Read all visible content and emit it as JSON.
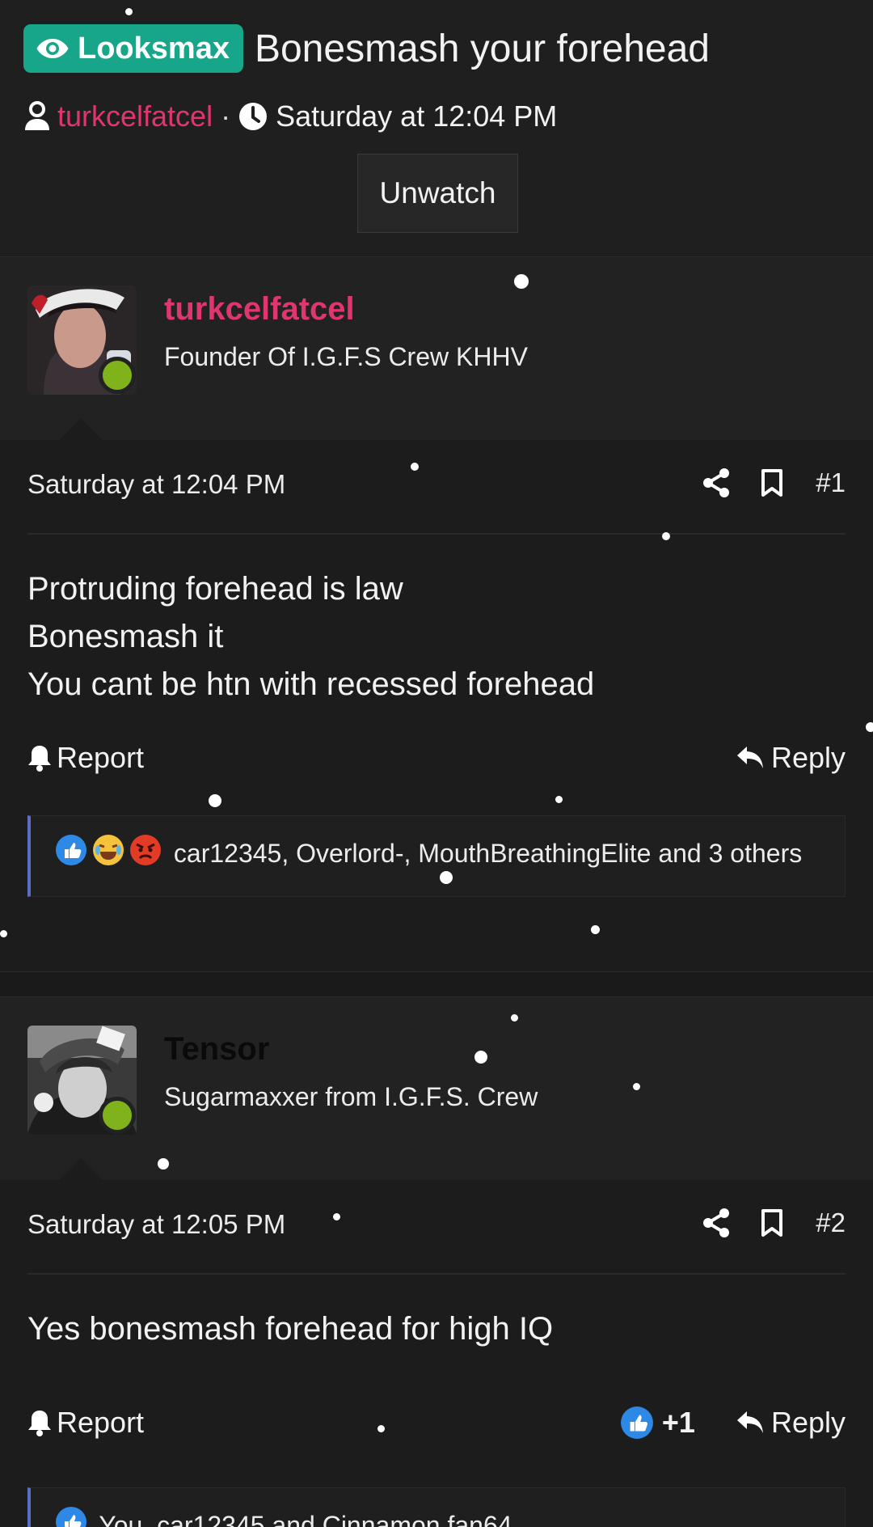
{
  "thread": {
    "prefix": "Looksmax",
    "title": "Bonesmash your forehead",
    "author": "turkcelfatcel",
    "separator": "·",
    "date": "Saturday at 12:04 PM",
    "unwatch_label": "Unwatch"
  },
  "posts": [
    {
      "username": "turkcelfatcel",
      "user_title": "Founder Of I.G.F.S Crew KHHV",
      "date": "Saturday at 12:04 PM",
      "number": "#1",
      "lines": [
        "Protruding forehead is law",
        "Bonesmash it",
        "You cant be htn with recessed forehead"
      ],
      "report_label": "Report",
      "reply_label": "Reply",
      "reactions_text": "car12345, Overlord-, MouthBreathingElite and 3 others"
    },
    {
      "username": "Tensor",
      "user_title": "Sugarmaxxer from I.G.F.S. Crew",
      "date": "Saturday at 12:05 PM",
      "number": "#2",
      "lines": [
        "Yes bonesmash forehead for high IQ"
      ],
      "report_label": "Report",
      "reply_label": "Reply",
      "reaction_count": "+1",
      "reactions_text": "You, car12345 and Cinnamon fan64"
    }
  ],
  "colors": {
    "accent": "#e0366e",
    "prefix_bg": "#17a689",
    "online": "#7fb21b",
    "reaction_bar": "#5b6ec1"
  }
}
